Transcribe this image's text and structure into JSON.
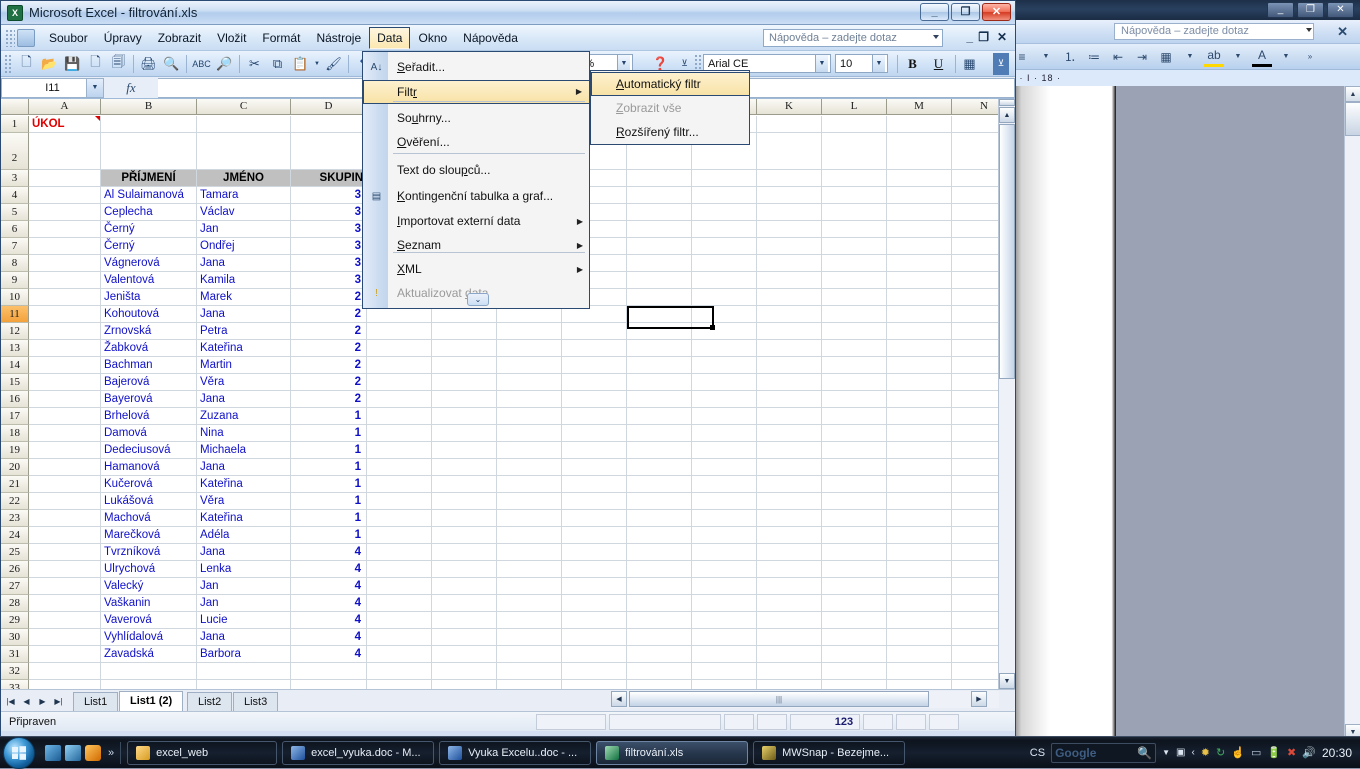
{
  "word_window": {
    "help_placeholder": "Nápověda – zadejte dotaz",
    "ruler_text": "7 ·  I  · 18 ·"
  },
  "excel": {
    "titlebar": {
      "title": "Microsoft Excel - filtrování.xls",
      "app_icon": "excel-icon",
      "minimize": "_",
      "restore": "❐",
      "close": "✕"
    },
    "menus": [
      {
        "label": "Soubor",
        "accel": "S"
      },
      {
        "label": "Úpravy",
        "accel": "a"
      },
      {
        "label": "Zobrazit",
        "accel": "b"
      },
      {
        "label": "Vložit",
        "accel": "ž"
      },
      {
        "label": "Formát",
        "accel": "F"
      },
      {
        "label": "Nástroje",
        "accel": "N"
      },
      {
        "label": "Data",
        "accel": "D",
        "active": true
      },
      {
        "label": "Okno",
        "accel": "O"
      },
      {
        "label": "Nápověda",
        "accel": "N"
      }
    ],
    "help_placeholder": "Nápověda – zadejte dotaz",
    "window_minimize": "_",
    "window_close": "✕",
    "toolbar": {
      "icons": [
        "new-icon",
        "open-icon",
        "save-icon",
        "mail-icon",
        "print-preview-mail-icon",
        "print-icon",
        "print-preview-icon",
        "spellcheck-icon",
        "research-icon",
        "cut-icon",
        "copy-icon",
        "paste-icon",
        "format-painter-icon",
        "undo-icon"
      ],
      "zoom_value": "100%",
      "help_circle": "help-icon",
      "font_name": "Arial CE",
      "font_size": "10",
      "bold": "B",
      "underline": "U",
      "borders_icon": "borders-icon"
    },
    "formula_bar": {
      "name_box": "I11",
      "fx": "fx",
      "formula": ""
    },
    "grid": {
      "columns": [
        "A",
        "B",
        "C",
        "D",
        "K",
        "L",
        "M"
      ],
      "row_numbers": [
        1,
        2,
        3,
        4,
        5,
        6,
        7,
        8,
        9,
        10,
        11,
        12,
        13,
        14,
        15,
        16,
        17,
        18,
        19,
        20,
        21,
        22,
        23,
        24,
        25,
        26,
        27,
        28,
        29,
        30,
        31,
        32,
        33
      ],
      "selected_row": 11,
      "cell_a1": "ÚKOL",
      "header_row": {
        "b": "PŘÍJMENÍ",
        "c": "JMÉNO",
        "d": "SKUPIN"
      },
      "rows": [
        {
          "row": 4,
          "prijmeni": "Al Sulaimanová",
          "jmeno": "Tamara",
          "skupina": "3"
        },
        {
          "row": 5,
          "prijmeni": "Ceplecha",
          "jmeno": "Václav",
          "skupina": "3"
        },
        {
          "row": 6,
          "prijmeni": "Černý",
          "jmeno": "Jan",
          "skupina": "3"
        },
        {
          "row": 7,
          "prijmeni": "Černý",
          "jmeno": "Ondřej",
          "skupina": "3"
        },
        {
          "row": 8,
          "prijmeni": "Vágnerová",
          "jmeno": "Jana",
          "skupina": "3"
        },
        {
          "row": 9,
          "prijmeni": "Valentová",
          "jmeno": "Kamila",
          "skupina": "3"
        },
        {
          "row": 10,
          "prijmeni": "Jeništa",
          "jmeno": "Marek",
          "skupina": "2"
        },
        {
          "row": 11,
          "prijmeni": "Kohoutová",
          "jmeno": "Jana",
          "skupina": "2"
        },
        {
          "row": 12,
          "prijmeni": "Zrnovská",
          "jmeno": "Petra",
          "skupina": "2"
        },
        {
          "row": 13,
          "prijmeni": "Žabková",
          "jmeno": "Kateřina",
          "skupina": "2"
        },
        {
          "row": 14,
          "prijmeni": "Bachman",
          "jmeno": "Martin",
          "skupina": "2"
        },
        {
          "row": 15,
          "prijmeni": "Bajerová",
          "jmeno": "Věra",
          "skupina": "2"
        },
        {
          "row": 16,
          "prijmeni": "Bayerová",
          "jmeno": "Jana",
          "skupina": "2"
        },
        {
          "row": 17,
          "prijmeni": "Brhelová",
          "jmeno": "Zuzana",
          "skupina": "1"
        },
        {
          "row": 18,
          "prijmeni": "Damová",
          "jmeno": "Nina",
          "skupina": "1"
        },
        {
          "row": 19,
          "prijmeni": "Dedeciusová",
          "jmeno": "Michaela",
          "skupina": "1"
        },
        {
          "row": 20,
          "prijmeni": "Hamanová",
          "jmeno": "Jana",
          "skupina": "1"
        },
        {
          "row": 21,
          "prijmeni": "Kučerová",
          "jmeno": "Kateřina",
          "skupina": "1"
        },
        {
          "row": 22,
          "prijmeni": "Lukášová",
          "jmeno": "Věra",
          "skupina": "1"
        },
        {
          "row": 23,
          "prijmeni": "Machová",
          "jmeno": "Kateřina",
          "skupina": "1"
        },
        {
          "row": 24,
          "prijmeni": "Marečková",
          "jmeno": "Adéla",
          "skupina": "1"
        },
        {
          "row": 25,
          "prijmeni": "Tvrzníková",
          "jmeno": "Jana",
          "skupina": "4"
        },
        {
          "row": 26,
          "prijmeni": "Ulrychová",
          "jmeno": "Lenka",
          "skupina": "4"
        },
        {
          "row": 27,
          "prijmeni": "Valecký",
          "jmeno": "Jan",
          "skupina": "4"
        },
        {
          "row": 28,
          "prijmeni": "Vaškanin",
          "jmeno": "Jan",
          "skupina": "4"
        },
        {
          "row": 29,
          "prijmeni": "Vaverová",
          "jmeno": "Lucie",
          "skupina": "4"
        },
        {
          "row": 30,
          "prijmeni": "Vyhlídalová",
          "jmeno": "Jana",
          "skupina": "4"
        },
        {
          "row": 31,
          "prijmeni": "Zavadská",
          "jmeno": "Barbora",
          "skupina": "4"
        }
      ]
    },
    "data_menu": {
      "items": [
        {
          "label": "Seřadit...",
          "accel": "S",
          "type": "item",
          "icon": "sort-az-icon"
        },
        {
          "label": "Filtr",
          "accel": "r",
          "type": "submenu",
          "highlighted": true
        },
        {
          "label": "Souhrny...",
          "accel": "u",
          "type": "item"
        },
        {
          "label": "Ověření...",
          "accel": "O",
          "type": "item"
        },
        {
          "label": "Text do sloupců...",
          "accel": "p",
          "type": "item"
        },
        {
          "label": "Kontingenční tabulka a graf...",
          "accel": "K",
          "type": "item",
          "icon": "pivot-table-icon"
        },
        {
          "label": "Importovat externí data",
          "accel": "I",
          "type": "submenu"
        },
        {
          "label": "Seznam",
          "accel": "S",
          "type": "submenu"
        },
        {
          "label": "XML",
          "accel": "X",
          "type": "submenu"
        },
        {
          "label": "Aktualizovat data",
          "accel": "d",
          "type": "item",
          "disabled": true,
          "icon": "refresh-icon"
        }
      ],
      "expander": "⌄"
    },
    "filter_submenu": {
      "items": [
        {
          "label": "Automatický filtr",
          "accel": "A",
          "highlighted": true
        },
        {
          "label": "Zobrazit vše",
          "accel": "Z",
          "disabled": true
        },
        {
          "label": "Rozšířený filtr...",
          "accel": "R"
        }
      ]
    },
    "sheet_tabs": [
      {
        "label": "List1",
        "active": false
      },
      {
        "label": "List1 (2)",
        "active": true
      },
      {
        "label": "List2",
        "active": false
      },
      {
        "label": "List3",
        "active": false
      }
    ],
    "status": {
      "text": "Připraven",
      "num_indicator": "123"
    }
  },
  "taskbar": {
    "start": "windows-orb",
    "quick_launch": [
      "show-desktop-icon",
      "switch-window-icon",
      "media-player-icon"
    ],
    "chevron": "»",
    "tasks": [
      {
        "label": "excel_web",
        "icon": "folder-icon"
      },
      {
        "label": "excel_vyuka.doc - M...",
        "icon": "word-icon"
      },
      {
        "label": "Vyuka Excelu..doc - ...",
        "icon": "word-icon"
      },
      {
        "label": "filtrování.xls",
        "icon": "excel-icon",
        "active": true
      },
      {
        "label": "MWSnap - Bezejme...",
        "icon": "mwsnap-icon"
      }
    ],
    "language": "CS",
    "search_placeholder": "Google",
    "tray_icons": [
      "search-icon",
      "dropdown-icon",
      "monitor-icon",
      "chevron-left-icon",
      "mwsnap-tray-icon",
      "refresh-tray-icon",
      "hand-tray-icon",
      "network-tray-icon",
      "battery-icon",
      "network-error-icon",
      "volume-icon"
    ],
    "clock": "20:30"
  }
}
